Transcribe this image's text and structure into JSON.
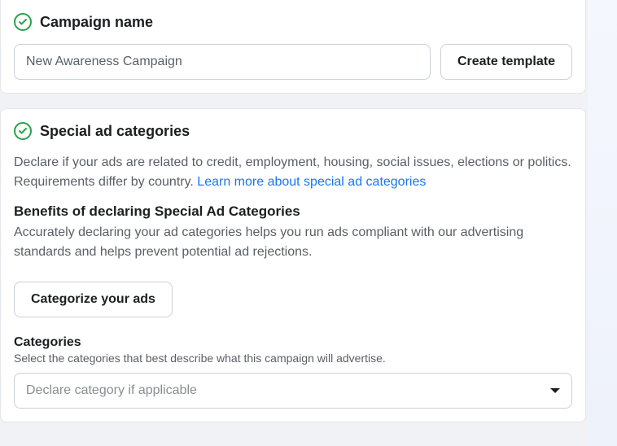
{
  "campaign": {
    "title": "Campaign name",
    "value": "New Awareness Campaign",
    "create_template": "Create template"
  },
  "special": {
    "title": "Special ad categories",
    "description_pre": "Declare if your ads are related to credit, employment, housing, social issues, elections or politics. Requirements differ by country. ",
    "learn_more": "Learn more about special ad categories",
    "benefits_heading": "Benefits of declaring Special Ad Categories",
    "benefits_body": "Accurately declaring your ad categories helps you run ads compliant with our advertising standards and helps prevent potential ad rejections.",
    "categorize_button": "Categorize your ads",
    "categories_label": "Categories",
    "categories_help": "Select the categories that best describe what this campaign will advertise.",
    "categories_placeholder": "Declare category if applicable"
  }
}
